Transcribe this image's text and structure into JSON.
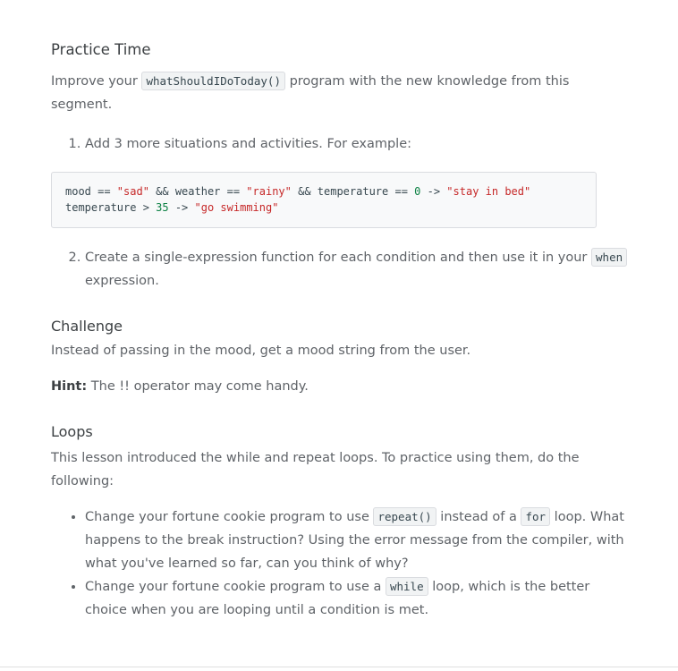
{
  "practice": {
    "title": "Practice Time",
    "intro_pre": "Improve your ",
    "intro_code": "whatShouldIDoToday()",
    "intro_post": " program with the new knowledge from this segment.",
    "items": [
      {
        "text": "Add 3 more situations and activities. For example:"
      },
      {
        "text_pre": "Create a single-expression function for each condition and then use it in your ",
        "code": "when",
        "text_post": " expression."
      }
    ],
    "codeblock": {
      "line1": {
        "a": "mood == ",
        "b": "\"sad\"",
        "c": " && weather == ",
        "d": "\"rainy\"",
        "e": " && temperature == ",
        "f": "0",
        "g": " -> ",
        "h": "\"stay in bed\""
      },
      "line2": {
        "a": "temperature > ",
        "b": "35",
        "c": " -> ",
        "d": "\"go swimming\""
      }
    }
  },
  "challenge": {
    "title": "Challenge",
    "text": "Instead of passing in the mood, get a mood string from the user.",
    "hint_label": "Hint:",
    "hint_text": " The !! operator may come handy."
  },
  "loops": {
    "title": "Loops",
    "text": "This lesson introduced the while and repeat loops. To practice using them, do the following:",
    "bullets": [
      {
        "pre": "Change your fortune cookie program to use ",
        "code1": "repeat()",
        "mid": " instead of a ",
        "code2": "for",
        "post": " loop. What happens to the break instruction? Using the error message from the compiler, with what you've learned so far, can you think of why?"
      },
      {
        "pre": "Change your fortune cookie program to use a ",
        "code1": "while",
        "post": " loop, which is the better choice when you are looping until a condition is met."
      }
    ]
  }
}
